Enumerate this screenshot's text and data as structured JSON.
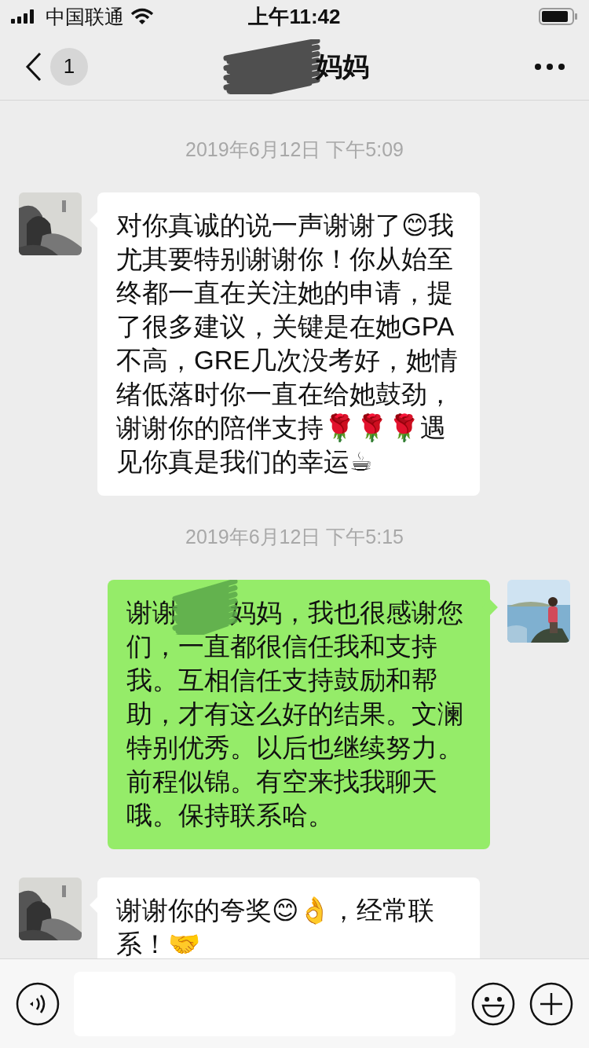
{
  "status_bar": {
    "carrier": "中国联通",
    "time": "上午11:42"
  },
  "header": {
    "unread_count": "1",
    "title": "妈妈",
    "redacted": true
  },
  "messages": [
    {
      "kind": "timestamp",
      "text": "2019年6月12日 下午5:09"
    },
    {
      "kind": "incoming",
      "text": "对你真诚的说一声谢谢了😊我尤其要特别谢谢你！你从始至终都一直在关注她的申请，提了很多建议，关键是在她GPA不高，GRE几次没考好，她情绪低落时你一直在给她鼓劲，谢谢你的陪伴支持🌹🌹🌹遇见你真是我们的幸运☕",
      "redacted": false
    },
    {
      "kind": "timestamp",
      "text": "2019年6月12日 下午5:15"
    },
    {
      "kind": "outgoing",
      "text": "谢谢　　妈妈，我也很感谢您们，一直都很信任我和支持我。互相信任支持鼓励和帮助，才有这么好的结果。文澜特别优秀。以后也继续努力。前程似锦。有空来找我聊天哦。保持联系哈。",
      "redacted": true
    },
    {
      "kind": "incoming",
      "text": "谢谢你的夸奖😊👌，经常联系！🤝",
      "redacted": false
    }
  ]
}
